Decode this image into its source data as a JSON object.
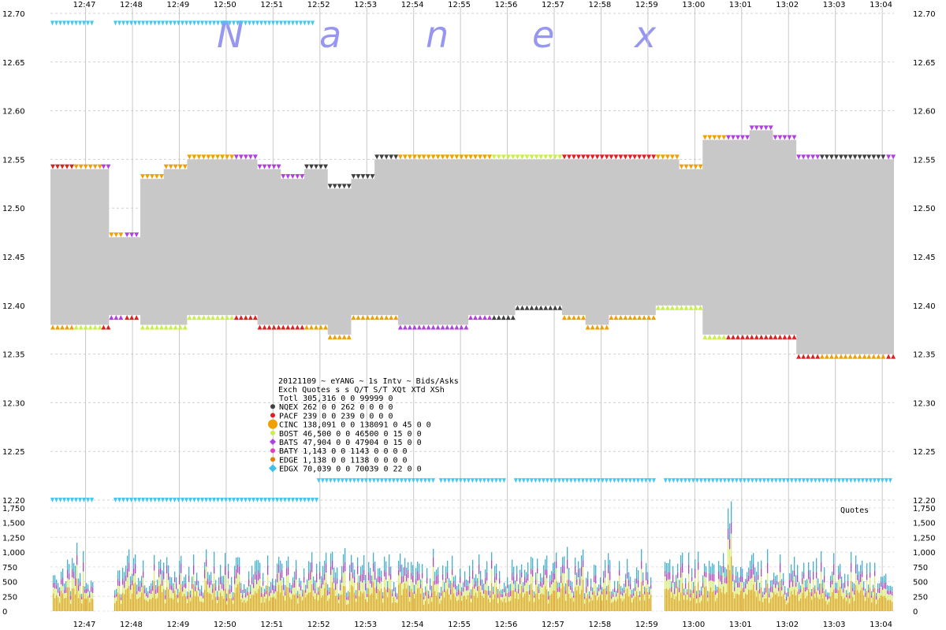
{
  "chart_data": [
    {
      "type": "area",
      "title": "20121109 ~ eYANG ~ 1s Intv ~ Bids/Asks",
      "watermark_letters": [
        "N",
        "a",
        "n",
        "e",
        "x"
      ],
      "x_ticks": [
        "12:47",
        "12:48",
        "12:49",
        "12:50",
        "12:51",
        "12:52",
        "12:53",
        "12:54",
        "12:55",
        "12:56",
        "12:57",
        "12:58",
        "12:59",
        "13:00",
        "13:01",
        "13:02",
        "13:03",
        "13:04"
      ],
      "y_ticks": [
        "12.70",
        "12.65",
        "12.60",
        "12.55",
        "12.50",
        "12.45",
        "12.40",
        "12.35",
        "12.30",
        "12.25",
        "12.20"
      ],
      "ylim": [
        12.2,
        12.7
      ],
      "xlim": [
        "12:46:15",
        "13:04:15"
      ],
      "grid": true,
      "nbbo_band": {
        "description_x": [
          "12:46:15",
          "12:46:45",
          "12:47:20",
          "12:47:30",
          "12:47:50",
          "12:48:10",
          "12:48:40",
          "12:49:10",
          "12:49:40",
          "12:50:10",
          "12:50:40",
          "12:51:10",
          "12:51:40",
          "12:52:10",
          "12:52:40",
          "12:53:10",
          "12:53:40",
          "12:54:10",
          "12:54:40",
          "12:55:10",
          "12:55:40",
          "12:56:10",
          "12:56:40",
          "12:57:10",
          "12:57:40",
          "12:58:10",
          "12:58:40",
          "12:59:10",
          "12:59:40",
          "13:00:10",
          "13:00:40",
          "13:01:10",
          "13:01:40",
          "13:02:10",
          "13:02:40",
          "13:03:10",
          "13:03:40",
          "13:04:05"
        ],
        "bid": [
          12.38,
          12.38,
          12.38,
          12.39,
          12.39,
          12.38,
          12.38,
          12.39,
          12.39,
          12.39,
          12.38,
          12.38,
          12.38,
          12.37,
          12.39,
          12.39,
          12.38,
          12.38,
          12.38,
          12.39,
          12.39,
          12.4,
          12.4,
          12.39,
          12.38,
          12.39,
          12.39,
          12.4,
          12.4,
          12.37,
          12.37,
          12.37,
          12.37,
          12.35,
          12.35,
          12.35,
          12.35,
          12.35
        ],
        "ask": [
          12.54,
          12.54,
          12.54,
          12.47,
          12.47,
          12.53,
          12.54,
          12.55,
          12.55,
          12.55,
          12.54,
          12.53,
          12.54,
          12.52,
          12.53,
          12.55,
          12.55,
          12.55,
          12.55,
          12.55,
          12.55,
          12.55,
          12.55,
          12.55,
          12.55,
          12.55,
          12.55,
          12.55,
          12.54,
          12.57,
          12.57,
          12.58,
          12.57,
          12.55,
          12.55,
          12.55,
          12.55,
          12.55
        ],
        "color": "#c8c8c8"
      },
      "edgx_ask_x": [
        "12:46:15",
        "12:47:00",
        "12:47:30",
        "12:51:55",
        "12:51:56",
        "13:04:05"
      ],
      "edgx_ask": [
        12.69,
        12.69,
        12.69,
        12.69,
        12.22,
        12.22
      ],
      "edgx_bid_x": [
        "12:46:15",
        "12:52:00"
      ],
      "edgx_bid": [
        12.2,
        12.2
      ],
      "edgx_gaps": [
        [
          "12:47:10",
          "12:47:35"
        ],
        [
          "12:54:25",
          "12:54:32"
        ],
        [
          "12:55:55",
          "12:56:05"
        ],
        [
          "12:59:05",
          "12:59:20"
        ]
      ],
      "legend": {
        "header": "Exch  Quotes s s  Q/T   S/T  XQt XTd XSh",
        "rows": [
          {
            "exch": "Totl",
            "line": "Totl 305,316 0 0 99999    0",
            "color": ""
          },
          {
            "exch": "NQEX",
            "line": "NQEX     262 0 0   262    0    0   0   0",
            "color": "#404040"
          },
          {
            "exch": "PACF",
            "line": "PACF     239 0 0   239    0    0   0   0",
            "color": "#e02020"
          },
          {
            "exch": "CINC",
            "line": "CINC 138,091 0 0 138091    0  45   0   0",
            "color": "#f0a000"
          },
          {
            "exch": "BOST",
            "line": "BOST  46,500 0 0  46500    0  15   0   0",
            "color": "#c8f048"
          },
          {
            "exch": "BATS",
            "line": "BATS  47,904 0 0  47904    0  15   0   0",
            "color": "#b040e0"
          },
          {
            "exch": "BATY",
            "line": "BATY   1,143 0 0   1143    0   0   0   0",
            "color": "#e040c0"
          },
          {
            "exch": "EDGE",
            "line": "EDGE   1,138 0 0   1138    0   0   0   0",
            "color": "#e08000"
          },
          {
            "exch": "EDGX",
            "line": "EDGX  70,039 0 0  70039    0  22   0   0",
            "color": "#40c0e8"
          }
        ]
      }
    },
    {
      "type": "bar",
      "title": "Quotes",
      "y_ticks": [
        "1,750",
        "1,500",
        "1,250",
        "1,000",
        "750",
        "500",
        "250",
        "0"
      ],
      "ylim": [
        0,
        1750
      ],
      "x_ticks": [
        "12:47",
        "12:48",
        "12:49",
        "12:50",
        "12:51",
        "12:52",
        "12:53",
        "12:54",
        "12:55",
        "12:56",
        "12:57",
        "12:58",
        "12:59",
        "13:00",
        "13:01",
        "13:02",
        "13:03",
        "13:04"
      ],
      "typical_total": 900,
      "spike": {
        "x": "13:00:45",
        "value": 1620
      },
      "gaps": [
        [
          "12:47:10",
          "12:47:35"
        ],
        [
          "12:59:05",
          "12:59:20"
        ]
      ],
      "series": [
        {
          "name": "CINC",
          "color": "#f0a000",
          "share": 0.45
        },
        {
          "name": "BOST",
          "color": "#d8f070",
          "share": 0.2
        },
        {
          "name": "BATS",
          "color": "#b040e0",
          "share": 0.15
        },
        {
          "name": "EDGX",
          "color": "#40b0e0",
          "share": 0.2
        }
      ]
    }
  ]
}
